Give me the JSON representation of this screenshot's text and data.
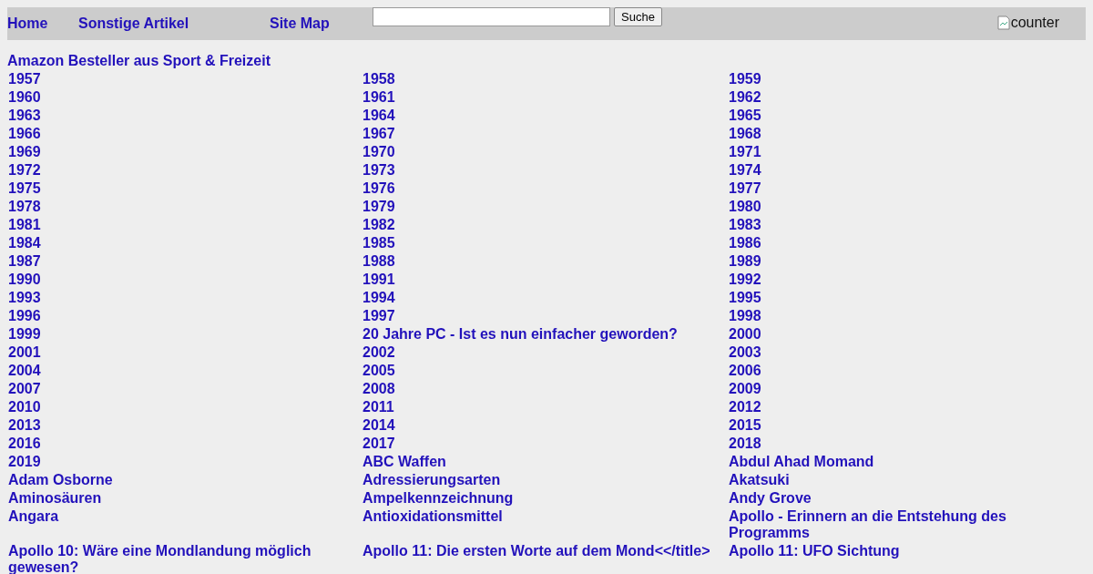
{
  "nav": [
    "Home",
    "Sonstige Artikel",
    "Site Map"
  ],
  "search": {
    "button": "Suche"
  },
  "counter": {
    "alt": "counter"
  },
  "heading": "Amazon Besteller aus Sport & Freizeit",
  "rows": [
    [
      "1957",
      "1958",
      "1959"
    ],
    [
      "1960",
      "1961",
      "1962"
    ],
    [
      "1963",
      "1964",
      "1965"
    ],
    [
      "1966",
      "1967",
      "1968"
    ],
    [
      "1969",
      "1970",
      "1971"
    ],
    [
      "1972",
      "1973",
      "1974"
    ],
    [
      "1975",
      "1976",
      "1977"
    ],
    [
      "1978",
      "1979",
      "1980"
    ],
    [
      "1981",
      "1982",
      "1983"
    ],
    [
      "1984",
      "1985",
      "1986"
    ],
    [
      "1987",
      "1988",
      "1989"
    ],
    [
      "1990",
      "1991",
      "1992"
    ],
    [
      "1993",
      "1994",
      "1995"
    ],
    [
      "1996",
      "1997",
      "1998"
    ],
    [
      "1999",
      "20 Jahre PC - Ist es nun einfacher geworden?",
      "2000"
    ],
    [
      "2001",
      "2002",
      "2003"
    ],
    [
      "2004",
      "2005",
      "2006"
    ],
    [
      "2007",
      "2008",
      "2009"
    ],
    [
      "2010",
      "2011",
      "2012"
    ],
    [
      "2013",
      "2014",
      "2015"
    ],
    [
      "2016",
      "2017",
      "2018"
    ],
    [
      "2019",
      "ABC Waffen",
      "Abdul Ahad Momand"
    ],
    [
      "Adam Osborne",
      "Adressierungsarten",
      "Akatsuki"
    ],
    [
      "Aminosäuren",
      "Ampelkennzeichnung",
      "Andy Grove"
    ],
    [
      "Angara",
      "Antioxidationsmittel",
      "Apollo - Erinnern an die Entstehung des Programms"
    ],
    [
      "Apollo 10: Wäre eine Mondlandung möglich gewesen?",
      "Apollo 11: Die ersten Worte auf dem Mond<</title>",
      "Apollo 11: UFO Sichtung"
    ]
  ]
}
